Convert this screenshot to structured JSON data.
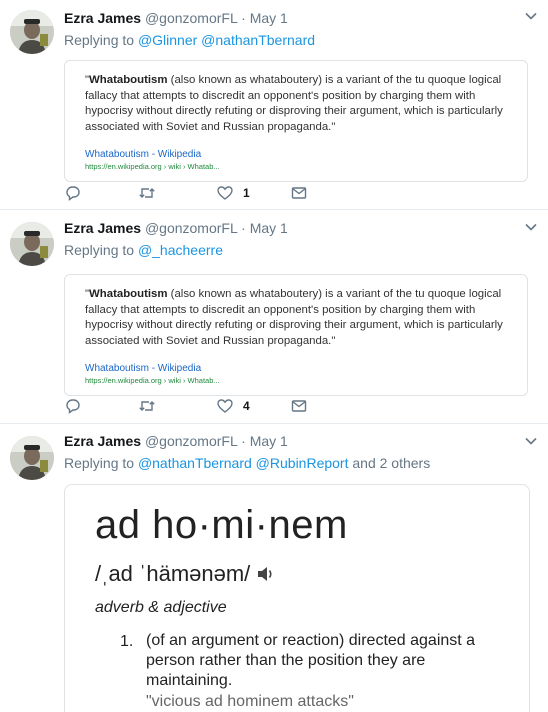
{
  "tweets": [
    {
      "name": "Ezra James",
      "handle": "@gonzomorFL",
      "dot": "·",
      "date": "May 1",
      "reply_prefix": "Replying to",
      "reply_targets": [
        "@Glinner",
        "@nathanTbernard"
      ],
      "reply_suffix": "",
      "quote": {
        "bold": "Whataboutism",
        "text": " (also known as whataboutery) is a variant of the tu quoque logical fallacy that attempts to discredit an opponent's position by charging them with hypocrisy without directly refuting or disproving their argument, which is particularly associated with Soviet and Russian propaganda.\"",
        "open_quote": "\"",
        "source_title": "Whataboutism - Wikipedia",
        "source_url": "https://en.wikipedia.org › wiki › Whatab..."
      },
      "actions": {
        "reply_count": "",
        "retweet_count": "",
        "like_count": "1"
      }
    },
    {
      "name": "Ezra James",
      "handle": "@gonzomorFL",
      "dot": "·",
      "date": "May 1",
      "reply_prefix": "Replying to",
      "reply_targets": [
        "@_hacheerre"
      ],
      "reply_suffix": "",
      "quote": {
        "bold": "Whataboutism",
        "text": " (also known as whataboutery) is a variant of the tu quoque logical fallacy that attempts to discredit an opponent's position by charging them with hypocrisy without directly refuting or disproving their argument, which is particularly associated with Soviet and Russian propaganda.\"",
        "open_quote": "\"",
        "source_title": "Whataboutism - Wikipedia",
        "source_url": "https://en.wikipedia.org › wiki › Whatab..."
      },
      "actions": {
        "reply_count": "",
        "retweet_count": "",
        "like_count": "4"
      }
    },
    {
      "name": "Ezra James",
      "handle": "@gonzomorFL",
      "dot": "·",
      "date": "May 1",
      "reply_prefix": "Replying to",
      "reply_targets": [
        "@nathanTbernard",
        "@RubinReport"
      ],
      "reply_suffix": "and 2 others",
      "dictionary": {
        "word": "ad ho·mi·nem",
        "pronunciation": "/ˌad ˈhämənəm/",
        "part_of_speech": "adverb & adjective",
        "number": "1.",
        "definition": "(of an argument or reaction) directed against a person rather than the position they are maintaining.",
        "example": "\"vicious ad hominem attacks\""
      }
    }
  ],
  "icons": {
    "reply": "reply-icon",
    "retweet": "retweet-icon",
    "like": "heart-icon",
    "dm": "envelope-icon",
    "caret": "chevron-down-icon",
    "speaker": "speaker-icon"
  },
  "colors": {
    "link": "#1b95e0",
    "muted": "#657786",
    "divider": "#e6ecf0",
    "wiki_link": "#1a66c9",
    "wiki_url": "#1f8a3c"
  }
}
